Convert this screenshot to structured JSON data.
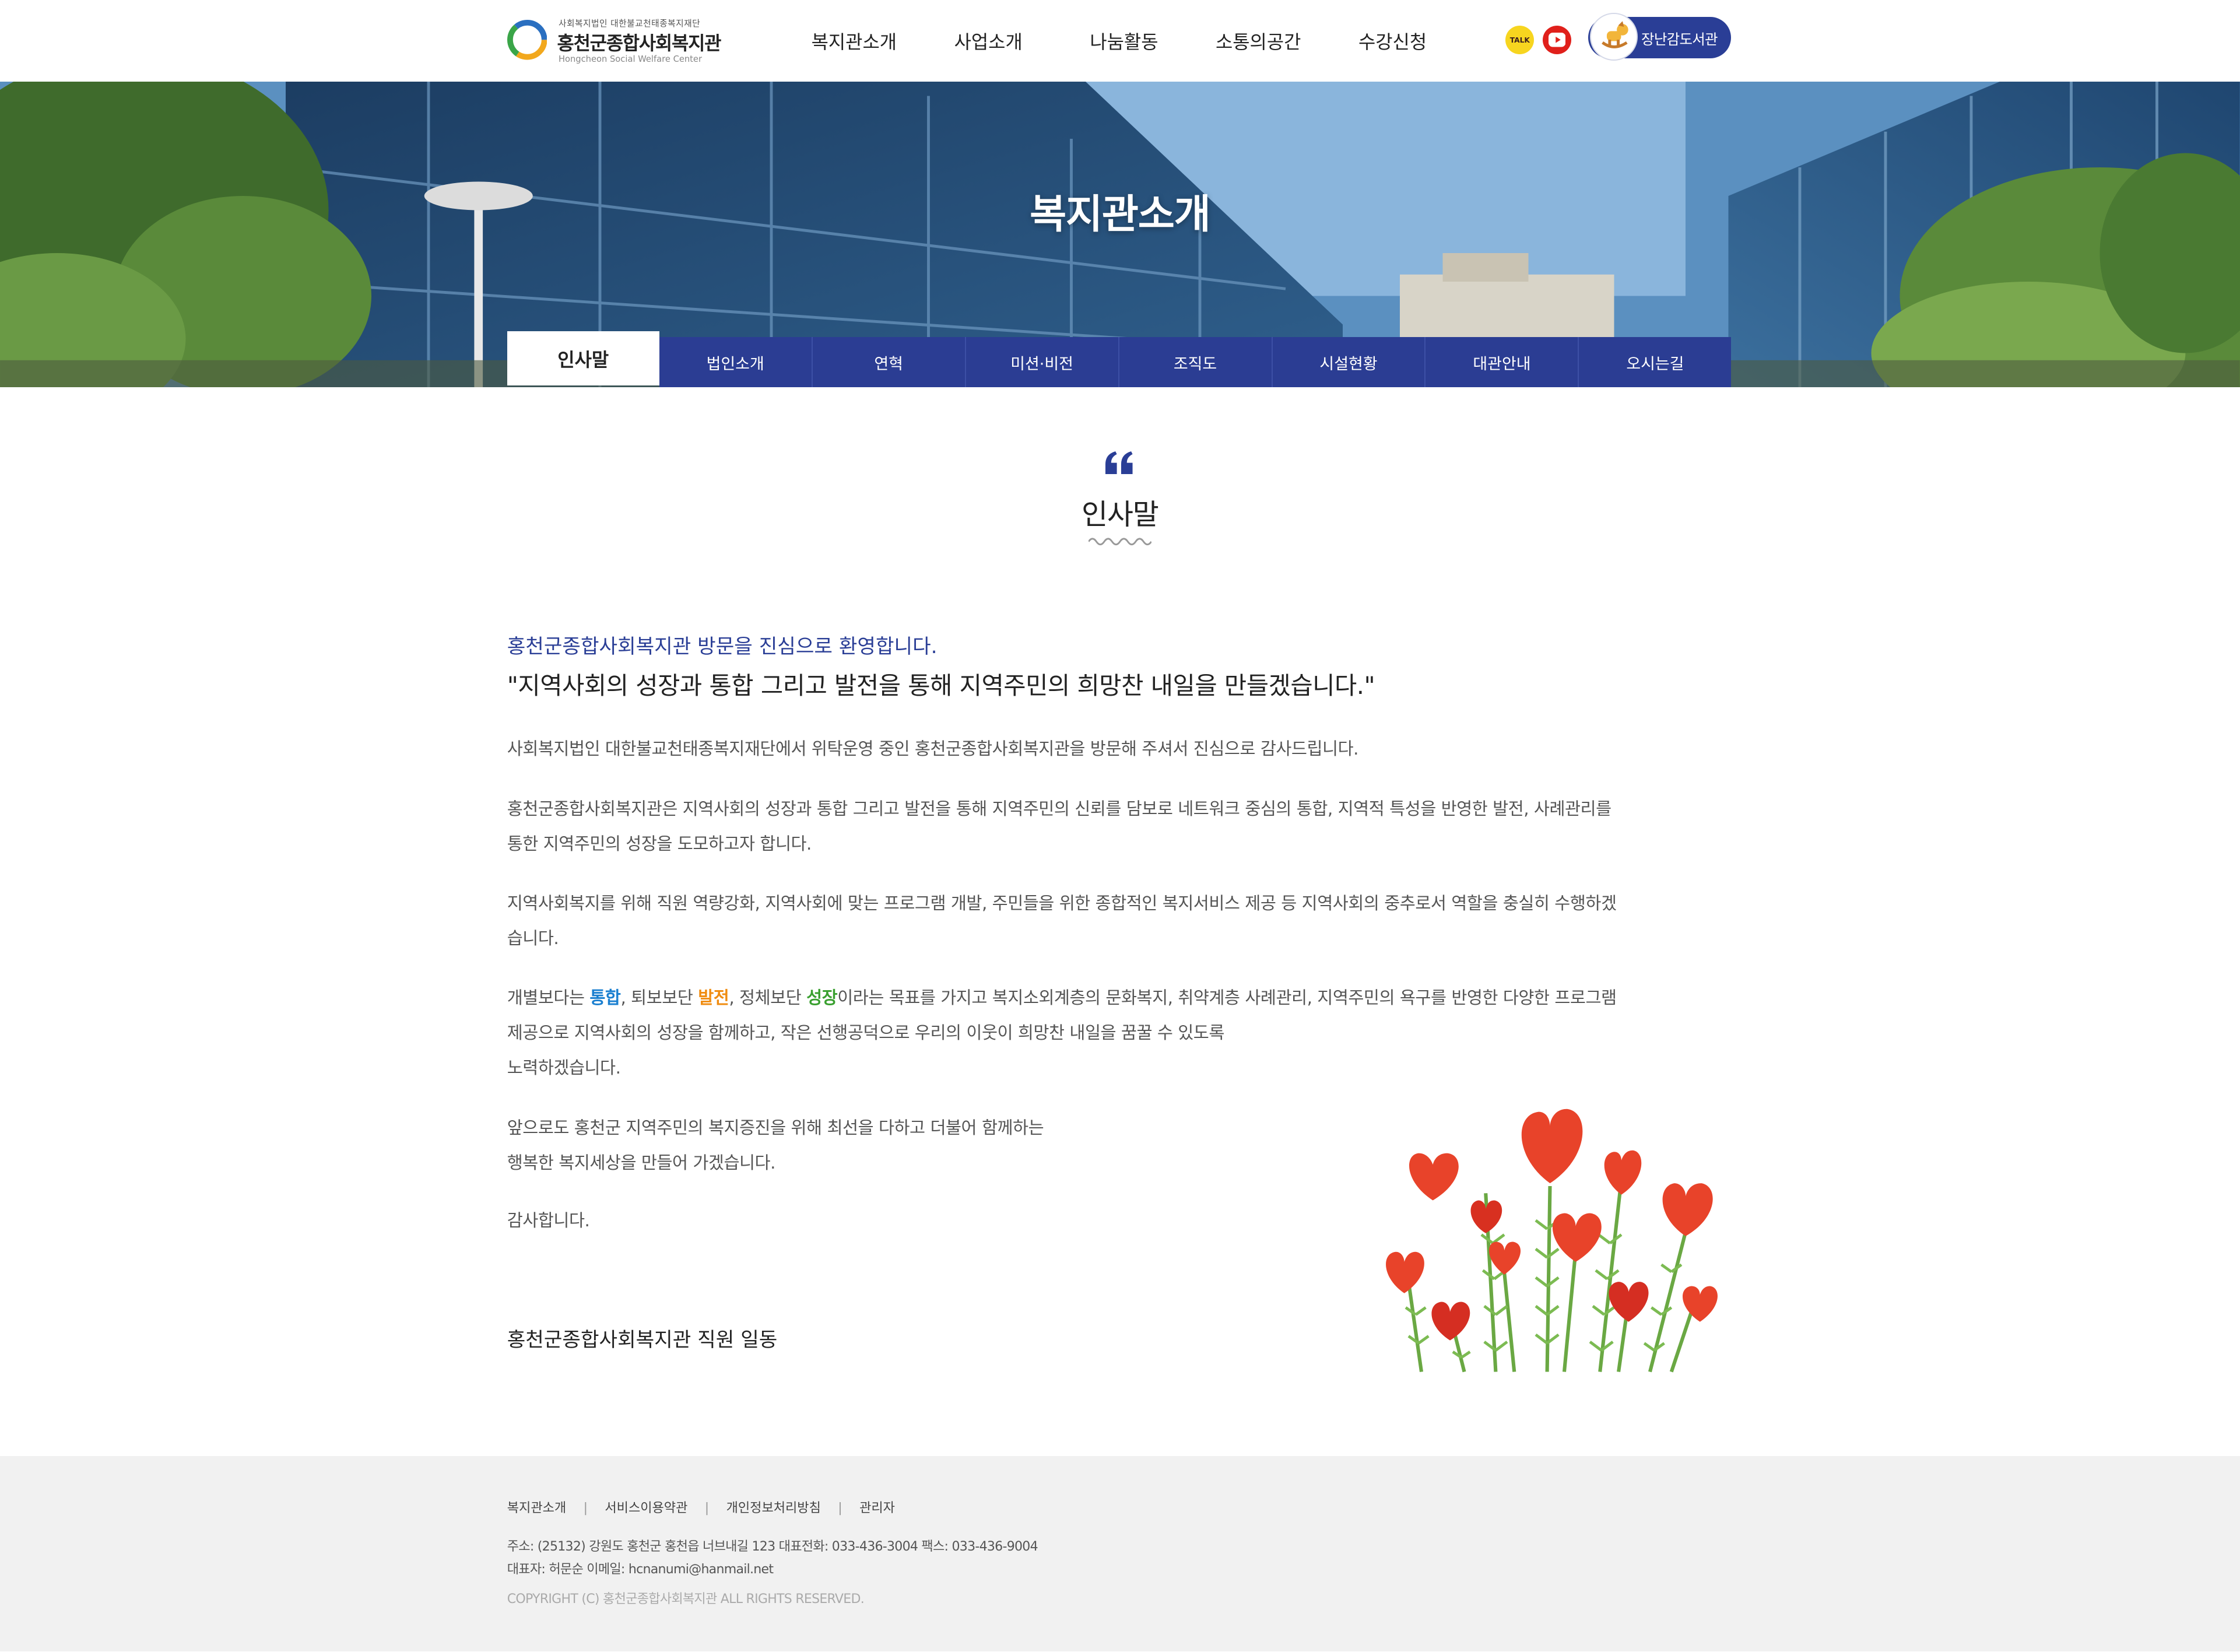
{
  "header": {
    "logo_sub": "사회복지법인 대한불교천태종복지재단",
    "logo_title": "홍천군종합사회복지관",
    "logo_en": "Hongcheon Social Welfare Center",
    "nav": [
      "복지관소개",
      "사업소개",
      "나눔활동",
      "소통의공간",
      "수강신청"
    ],
    "kakao_label": "TALK",
    "library_label": "장난감도서관",
    "icons": {
      "kakao": "kakao-talk-icon",
      "youtube": "youtube-icon",
      "library": "rocking-horse-icon"
    }
  },
  "banner": {
    "title": "복지관소개",
    "tabs": [
      "인사말",
      "법인소개",
      "연혁",
      "미션·비전",
      "조직도",
      "시설현황",
      "대관안내",
      "오시는길"
    ],
    "active_tab": "인사말"
  },
  "content": {
    "section_title": "인사말",
    "lead1": "홍천군종합사회복지관 방문을 진심으로 환영합니다.",
    "lead2": "\"지역사회의 성장과 통합 그리고 발전을 통해 지역주민의 희망찬 내일을 만들겠습니다.\"",
    "p1": "사회복지법인 대한불교천태종복지재단에서 위탁운영 중인 홍천군종합사회복지관을 방문해 주셔서 진심으로 감사드립니다.",
    "p2_line1": "홍천군종합사회복지관은 지역사회의 성장과 통합 그리고 발전을 통해 지역주민의 신뢰를 담보로 네트워크 중심의 통합, 지역적 특성을 반영한 발전, 사례관리를",
    "p2_line2": "통한 지역주민의 성장을 도모하고자 합니다.",
    "p3_line1": "지역사회복지를 위해 직원 역량강화, 지역사회에 맞는 프로그램 개발, 주민들을 위한 종합적인 복지서비스 제공 등 지역사회의 중추로서 역할을 충실히 수행하겠",
    "p3_line2": "습니다.",
    "p4_pre": "개별보다는 ",
    "p4_hl1": "통합",
    "p4_mid1": ", 퇴보보단 ",
    "p4_hl2": "발전",
    "p4_mid2": ", 정체보단 ",
    "p4_hl3": "성장",
    "p4_rest": "이라는 목표를 가지고 복지소외계층의 문화복지, 취약계층 사례관리, 지역주민의 욕구를 반영한 다양한 프로그램",
    "p4_line2": "제공으로 지역사회의 성장을 함께하고, 작은 선행공덕으로 우리의 이웃이 희망찬 내일을 꿈꿀 수 있도록",
    "p4_line3": "노력하겠습니다.",
    "p5_line1": "앞으로도 홍천군 지역주민의 복지증진을 위해 최선을 다하고 더불어 함께하는",
    "p5_line2": "행복한 복지세상을 만들어 가겠습니다.",
    "p6": "감사합니다.",
    "sign": "홍천군종합사회복지관 직원 일동",
    "colors": {
      "primary": "#2a3e96",
      "blue": "#1a7fd0",
      "orange": "#f08c10",
      "green": "#3aa030"
    }
  },
  "footer": {
    "links": [
      "복지관소개",
      "서비스이용약관",
      "개인정보처리방침",
      "관리자"
    ],
    "address": "주소: (25132) 강원도 홍천군 홍천읍 너브내길 123    대표전화: 033-436-3004    팩스: 033-436-9004",
    "rep": "대표자: 허문순    이메일: hcnanumi@hanmail.net",
    "copyright": "COPYRIGHT (C) 홍천군종합사회복지관 ALL RIGHTS RESERVED."
  }
}
